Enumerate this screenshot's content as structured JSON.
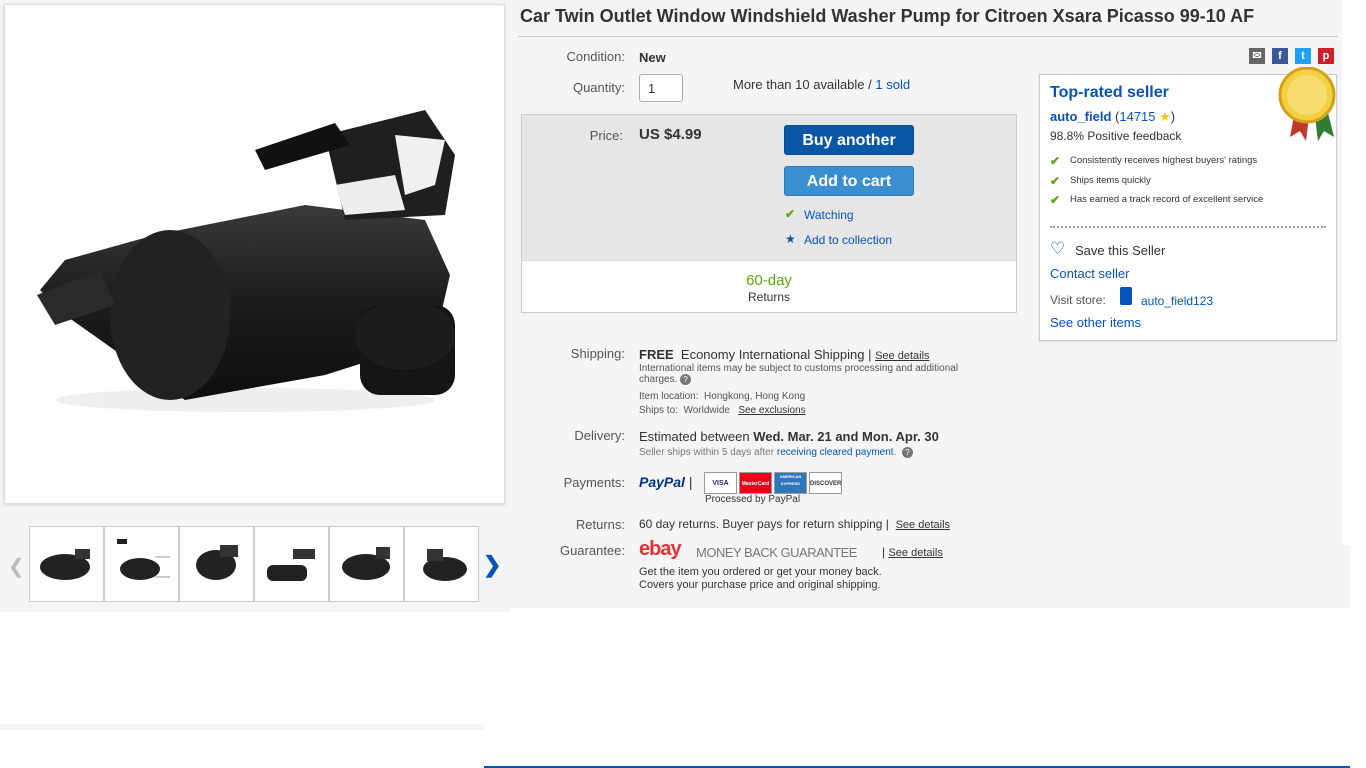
{
  "title": "Car Twin Outlet Window Windshield Washer Pump for Citroen Xsara Picasso 99-10 AF",
  "condition": {
    "label": "Condition:",
    "value": "New"
  },
  "quantity": {
    "label": "Quantity:",
    "value": "1",
    "available": "More than 10 available / ",
    "sold": "1 sold"
  },
  "price": {
    "label": "Price:",
    "value": "US $4.99"
  },
  "buttons": {
    "buy": "Buy another",
    "cart": "Add to cart",
    "watching": "Watching",
    "collection": "Add to collection"
  },
  "returns_box": {
    "days": "60-day",
    "label": "Returns"
  },
  "shipping": {
    "label": "Shipping:",
    "free": "FREE",
    "method": "Economy International Shipping |",
    "details": "See details",
    "note": "International items may be subject to customs processing and additional charges.",
    "location_label": "Item location:",
    "location": "Hongkong, Hong Kong",
    "ships_label": "Ships to:",
    "ships": "Worldwide",
    "exclusions": "See exclusions"
  },
  "delivery": {
    "label": "Delivery:",
    "prefix": "Estimated between ",
    "dates": "Wed. Mar. 21 and Mon. Apr. 30",
    "note": "Seller ships within 5 days after",
    "note_link": "receiving cleared payment",
    "note_end": "."
  },
  "payments": {
    "label": "Payments:",
    "paypal": "PayPal",
    "processed": "Processed by PayPal",
    "cards": [
      "VISA",
      "MasterCard",
      "AMERICAN EXPRESS",
      "DISCOVER"
    ]
  },
  "returns": {
    "label": "Returns:",
    "text": "60 day returns. Buyer pays for return shipping |",
    "details": "See details"
  },
  "guarantee": {
    "label": "Guarantee:",
    "logo": "ebay",
    "text": "MONEY BACK GUARANTEE",
    "details": "See details",
    "line1": "Get the item you ordered or get your money back.",
    "line2": "Covers your purchase price and original shipping."
  },
  "seller": {
    "heading": "Top-rated seller",
    "name": "auto_field",
    "score": "14715",
    "feedback": "98.8% Positive feedback",
    "bullets": [
      "Consistently receives highest buyers' ratings",
      "Ships items quickly",
      "Has earned a track record of excellent service"
    ],
    "save": "Save this Seller",
    "contact": "Contact seller",
    "visit_label": "Visit store:",
    "store": "auto_field123",
    "other": "See other items"
  },
  "colors": {
    "link": "#0654ba",
    "buy": "#0b57a7",
    "cart": "#3a8fd0",
    "check": "#5ba70b",
    "returns_green": "#5ba70b"
  }
}
